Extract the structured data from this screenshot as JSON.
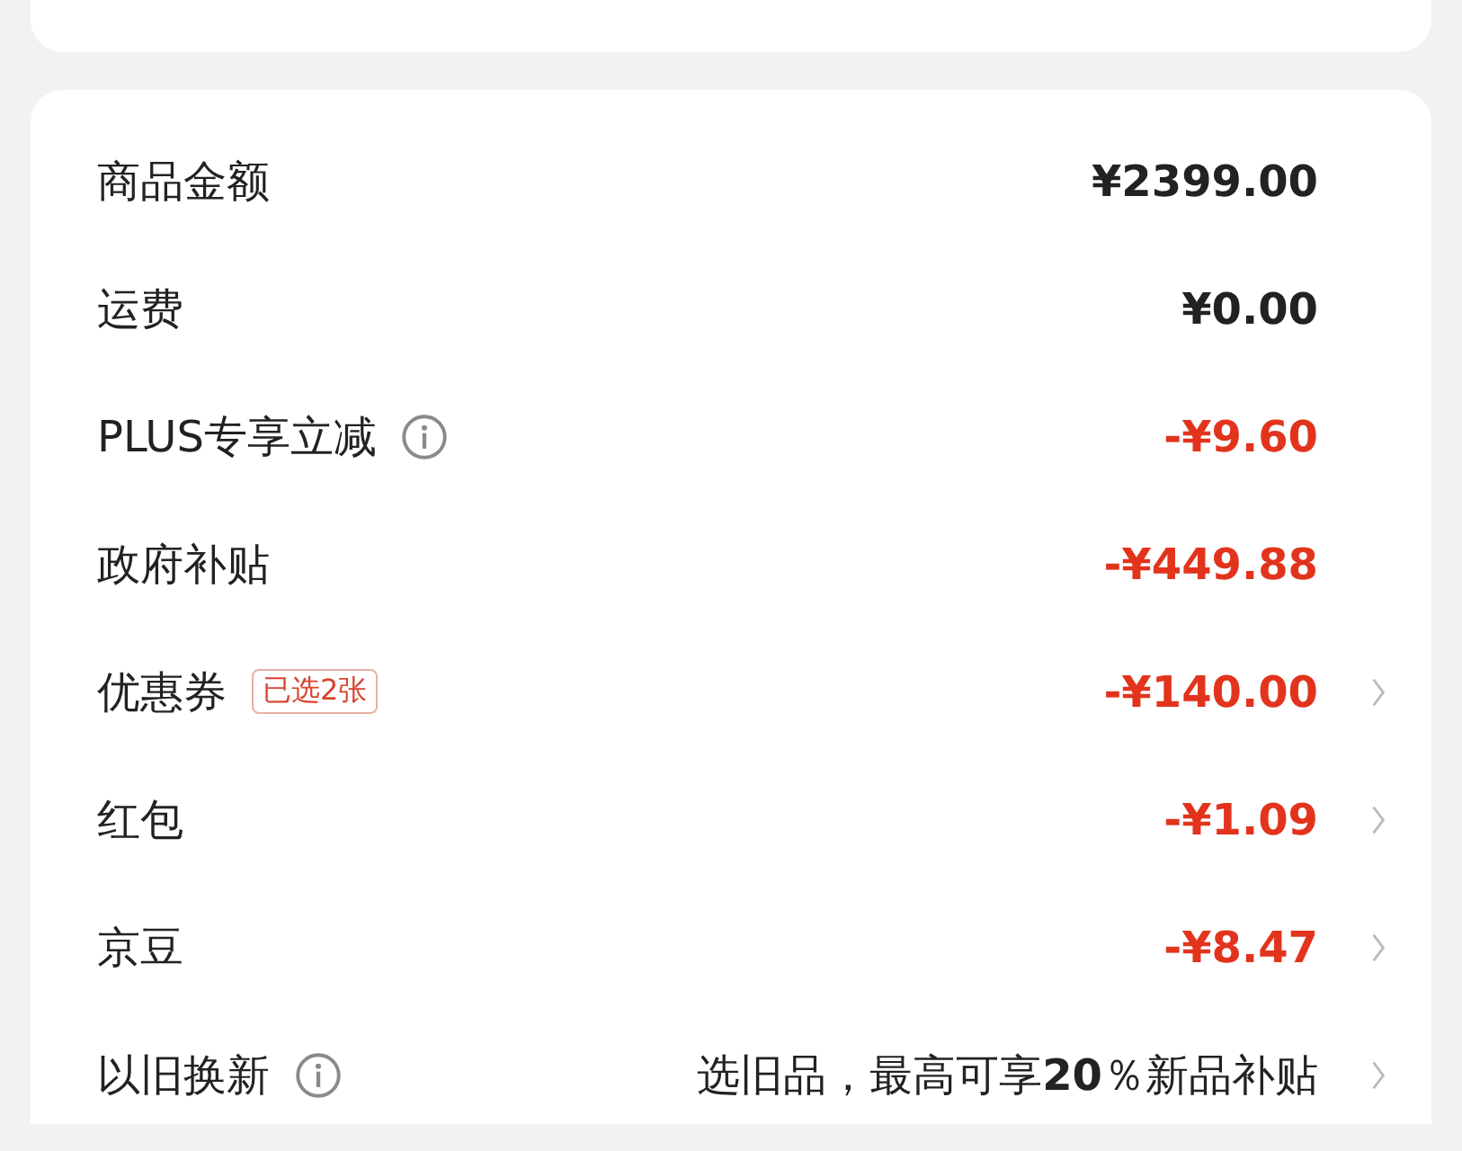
{
  "summary": {
    "rows": [
      {
        "label": "商品金额",
        "info": false,
        "value": "¥2399.00",
        "kind": "amount",
        "chevron": false
      },
      {
        "label": "运费",
        "info": false,
        "value": "¥0.00",
        "kind": "amount",
        "chevron": false
      },
      {
        "label": "PLUS专享立减",
        "info": true,
        "value": "-¥9.60",
        "kind": "discount",
        "chevron": false
      },
      {
        "label": "政府补贴",
        "info": false,
        "value": "-¥449.88",
        "kind": "discount",
        "chevron": false
      },
      {
        "label": "优惠券",
        "info": false,
        "badge": "已选2张",
        "value": "-¥140.00",
        "kind": "discount",
        "chevron": true
      },
      {
        "label": "红包",
        "info": false,
        "value": "-¥1.09",
        "kind": "discount",
        "chevron": true
      },
      {
        "label": "京豆",
        "info": false,
        "value": "-¥8.47",
        "kind": "discount",
        "chevron": true
      },
      {
        "label": "以旧换新",
        "info": true,
        "value": "选旧品，最高可享**20**％新品补贴",
        "kind": "note",
        "chevron": true
      }
    ]
  }
}
